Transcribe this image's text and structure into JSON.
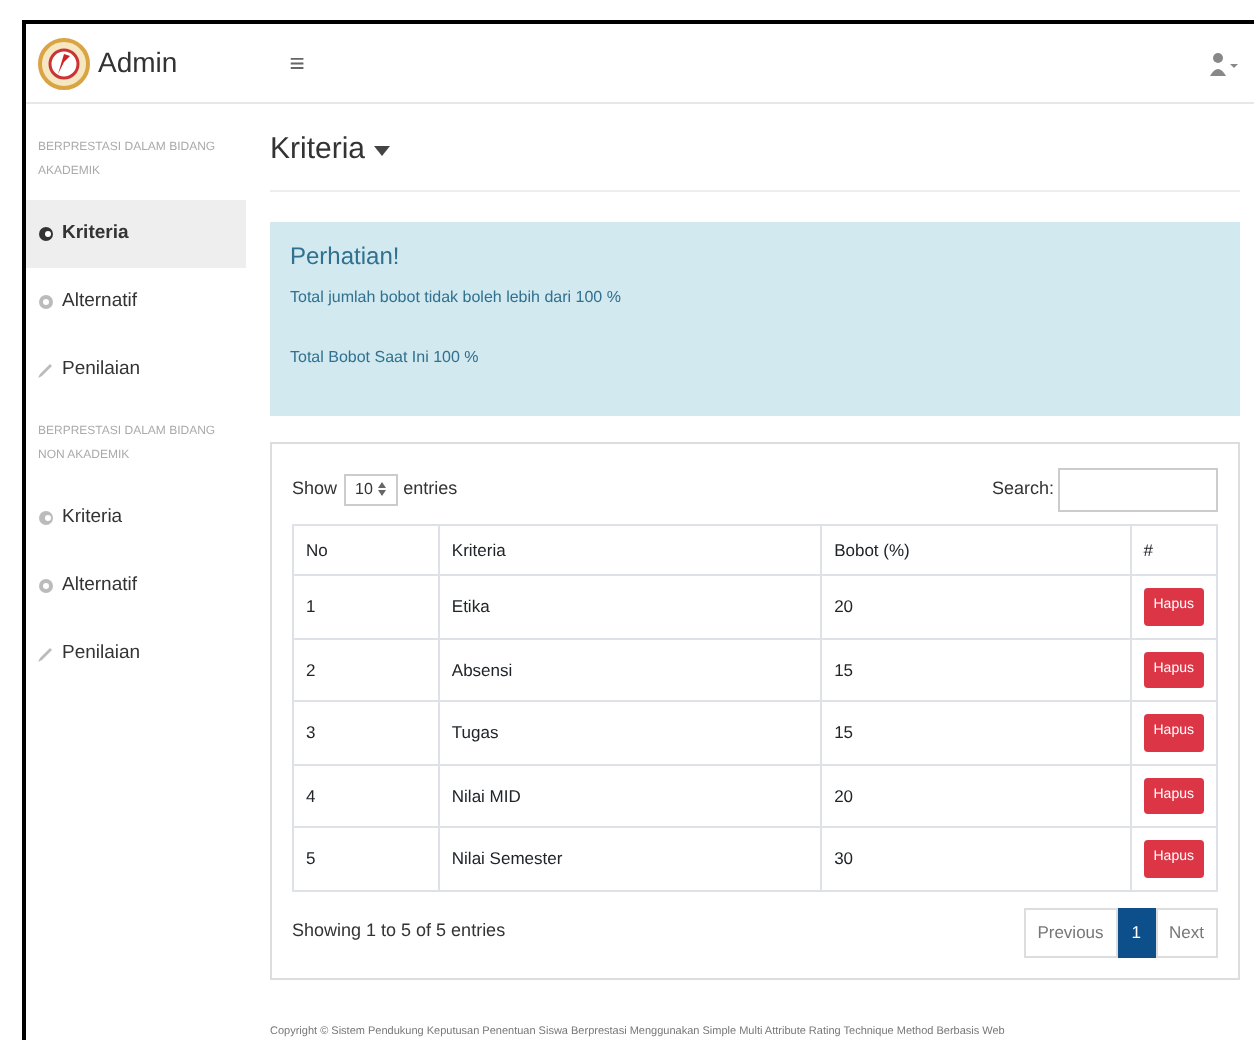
{
  "navbar": {
    "brand": "Admin",
    "menu_toggle": "≡"
  },
  "sidebar": {
    "sections": [
      {
        "heading": "BERPRESTASI DALAM BIDANG AKADEMIK",
        "items": [
          {
            "label": "Kriteria",
            "kind": "criteria",
            "selected": true
          },
          {
            "label": "Alternatif",
            "kind": "alternative",
            "selected": false
          },
          {
            "label": "Penilaian",
            "kind": "assessment",
            "selected": false
          }
        ]
      },
      {
        "heading": "BERPRESTASI DALAM BIDANG NON AKADEMIK",
        "items": [
          {
            "label": "Kriteria",
            "kind": "criteria",
            "selected": false
          },
          {
            "label": "Alternatif",
            "kind": "alternative",
            "selected": false
          },
          {
            "label": "Penilaian",
            "kind": "assessment",
            "selected": false
          }
        ]
      }
    ]
  },
  "page_title": "Kriteria",
  "alert": {
    "title": "Perhatian!",
    "lines": [
      "Total jumlah bobot tidak boleh lebih dari 100 %",
      "Total Bobot Saat Ini 100 %"
    ]
  },
  "table_controls": {
    "show_label": "Show",
    "page_size": "10",
    "entries_label": "entries",
    "search_label": "Search:"
  },
  "table": {
    "columns": [
      "No",
      "Kriteria",
      "Bobot (%)",
      "#"
    ],
    "rows": [
      {
        "no": "1",
        "kriteria": "Etika",
        "bobot": "20",
        "action": "Hapus"
      },
      {
        "no": "2",
        "kriteria": "Absensi",
        "bobot": "15",
        "action": "Hapus"
      },
      {
        "no": "3",
        "kriteria": "Tugas",
        "bobot": "15",
        "action": "Hapus"
      },
      {
        "no": "4",
        "kriteria": "Nilai MID",
        "bobot": "20",
        "action": "Hapus"
      },
      {
        "no": "5",
        "kriteria": "Nilai Semester",
        "bobot": "30",
        "action": "Hapus"
      }
    ]
  },
  "table_info": "Showing 1 to 5 of 5 entries",
  "pagination": [
    {
      "label": "Previous",
      "selected": false
    },
    {
      "label": "1",
      "selected": true
    },
    {
      "label": "Next",
      "selected": false
    }
  ],
  "footer": "Copyright © Sistem Pendukung Keputusan Penentuan Siswa Berprestasi Menggunakan Simple Multi Attribute Rating Technique Method Berbasis Web"
}
